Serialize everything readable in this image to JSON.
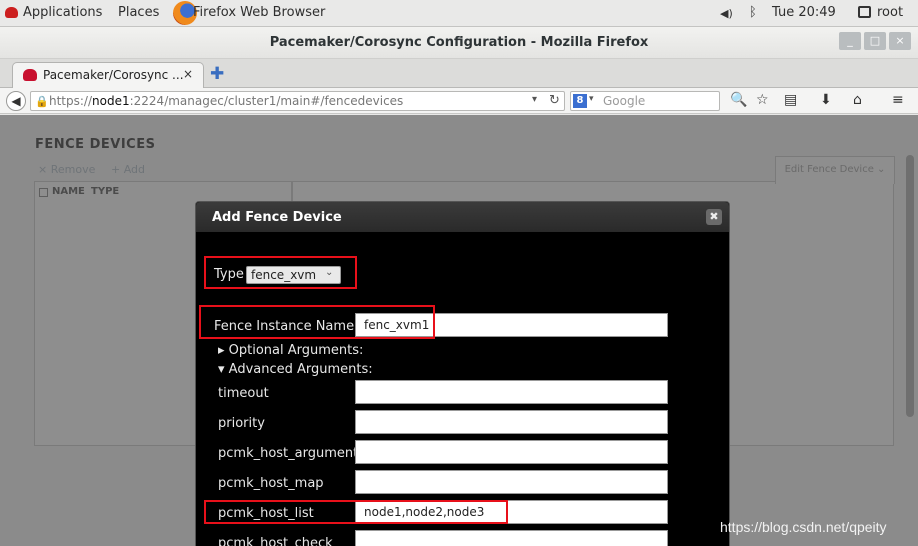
{
  "topbar": {
    "applications": "Applications",
    "places": "Places",
    "firefox_label": "Firefox Web Browser",
    "clock": "Tue 20:49",
    "user": "root"
  },
  "window": {
    "title": "Pacemaker/Corosync Configuration - Mozilla Firefox",
    "minimize": "_",
    "maximize": "□",
    "close": "×"
  },
  "tab": {
    "label": "Pacemaker/Corosync ...",
    "close": "×",
    "new_tab": "✚"
  },
  "nav": {
    "url_prefix": "https://",
    "url_host": "node1",
    "url_rest": ":2224/managec/cluster1/main#/fencedevices",
    "search_placeholder": "Google",
    "search_engine": "8"
  },
  "page": {
    "section_title": "FENCE DEVICES",
    "remove": "× Remove",
    "add": "+ Add",
    "col_name": "NAME",
    "col_type": "TYPE",
    "edit_button": "Edit Fence Device ⌄"
  },
  "dialog": {
    "title": "Add Fence Device",
    "type_label": "Type",
    "type_value": "fence_xvm",
    "instance_label": "Fence Instance Name",
    "instance_value": "fenc_xvm1",
    "optional_args": "▸ Optional Arguments:",
    "advanced_args": "▾ Advanced Arguments:",
    "fields": [
      {
        "label": "timeout",
        "value": ""
      },
      {
        "label": "priority",
        "value": ""
      },
      {
        "label": "pcmk_host_argument",
        "value": ""
      },
      {
        "label": "pcmk_host_map",
        "value": ""
      },
      {
        "label": "pcmk_host_list",
        "value": "node1,node2,node3"
      },
      {
        "label": "pcmk_host_check",
        "value": ""
      }
    ]
  },
  "watermark": "https://blog.csdn.net/qpeity",
  "colors": {
    "highlight": "#e8101a",
    "dialog_bg": "#000000",
    "overlay": "#8b8b8b"
  }
}
